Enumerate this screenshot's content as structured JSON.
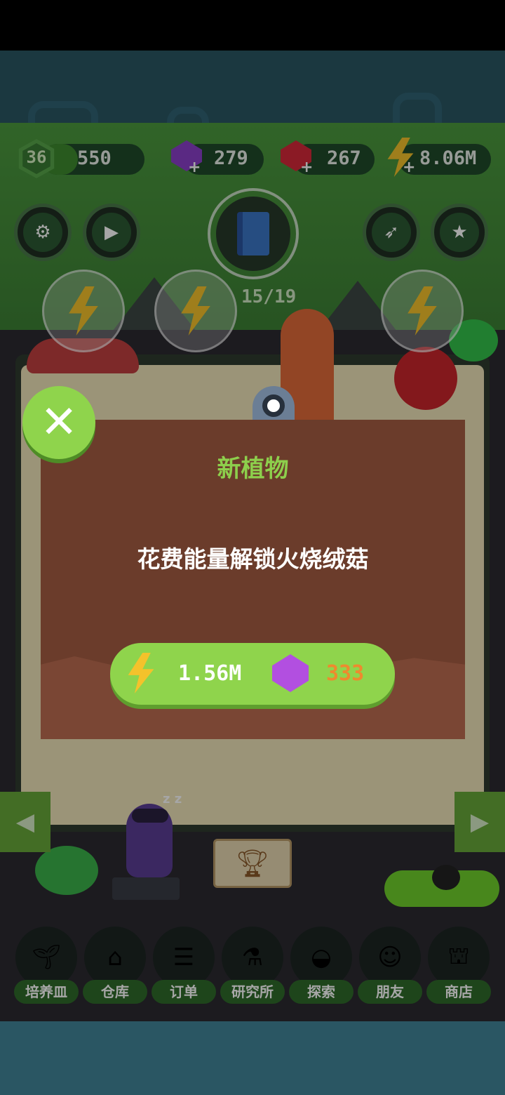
{
  "hud": {
    "level": "36",
    "xp": "550",
    "xp_progress": 0.35,
    "gems": "279",
    "rubies": "267",
    "energy": "8.06M",
    "gem_icon": "purple-gem-icon",
    "ruby_icon": "red-ruby-icon",
    "energy_icon": "lightning-bolt-icon"
  },
  "toolbar": {
    "settings_icon": "gear-icon",
    "video_icon": "video-camera-icon",
    "rocket_icon": "rocket-icon",
    "shoe_icon": "sneaker-icon"
  },
  "collection": {
    "icon": "plant-book-icon",
    "progress": "15/19",
    "collected": 15,
    "total": 19
  },
  "dialog": {
    "title": "新植物",
    "message": "花费能量解锁火烧绒菇",
    "energy_cost": "1.56M",
    "gem_cost": "333",
    "close_icon": "close-x-icon"
  },
  "nav": {
    "prev_icon": "chevron-left-icon",
    "next_icon": "chevron-right-icon",
    "trophy_icon": "trophy-icon"
  },
  "bottom_nav": [
    {
      "label": "培养皿",
      "icon": "sprout-icon"
    },
    {
      "label": "仓库",
      "icon": "barn-icon"
    },
    {
      "label": "订单",
      "icon": "scroll-icon"
    },
    {
      "label": "研究所",
      "icon": "lab-icon"
    },
    {
      "label": "探索",
      "icon": "hot-air-balloon-icon"
    },
    {
      "label": "朋友",
      "icon": "friends-icon"
    },
    {
      "label": "商店",
      "icon": "shop-icon"
    }
  ],
  "colors": {
    "accent_green": "#8fd44c",
    "dialog_brown": "#6b3c2b",
    "gem_cost_orange": "#ee8a2e",
    "title_green": "#8dcf4c"
  }
}
